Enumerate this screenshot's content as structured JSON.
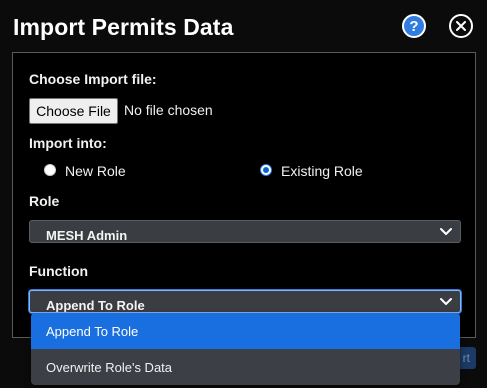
{
  "dialog": {
    "title": "Import Permits Data",
    "help_icon": "question-icon",
    "close_icon": "close-icon",
    "help_glyph": "?"
  },
  "form": {
    "file_label": "Choose Import file:",
    "file_button": "Choose File",
    "file_status": "No file chosen",
    "import_into_label": "Import into:",
    "options": [
      {
        "label": "New Role",
        "selected": false
      },
      {
        "label": "Existing Role",
        "selected": true
      }
    ],
    "role_label": "Role",
    "role_value": "MESH Admin",
    "function_label": "Function",
    "function_value": "Append To Role",
    "function_options": [
      "Append To Role",
      "Overwrite Role's Data"
    ]
  },
  "footer": {
    "action_fragment": "rt"
  },
  "colors": {
    "accent": "#2f7de1",
    "selected_option": "#1a6fe0",
    "select_bg": "#3a3d42",
    "background": "#000000"
  }
}
